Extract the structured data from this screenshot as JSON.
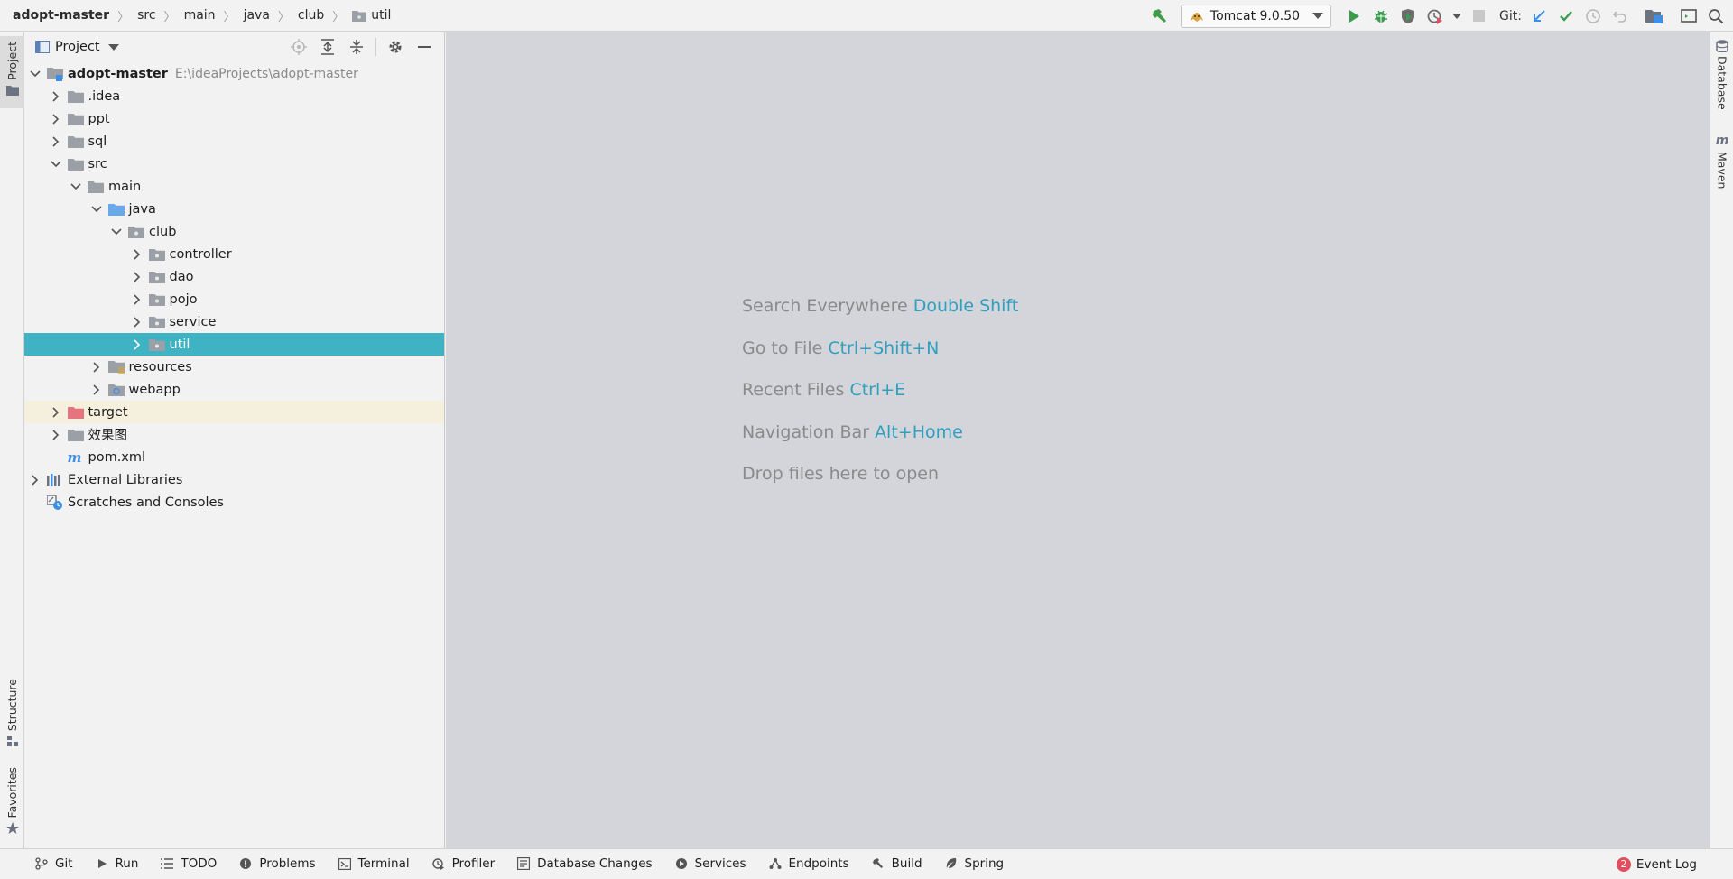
{
  "breadcrumb": [
    {
      "label": "adopt-master"
    },
    {
      "label": "src"
    },
    {
      "label": "main"
    },
    {
      "label": "java"
    },
    {
      "label": "club"
    },
    {
      "label": "util"
    }
  ],
  "toolbar": {
    "run_config_label": "Tomcat 9.0.50",
    "git_label": "Git:"
  },
  "left_stripe": {
    "project_tab": "Project",
    "structure_tab": "Structure",
    "favorites_tab": "Favorites"
  },
  "right_stripe": {
    "database_tab": "Database",
    "maven_tab": "Maven"
  },
  "project_panel": {
    "title": "Project",
    "tree": [
      {
        "label": "adopt-master",
        "path": "E:\\ideaProjects\\adopt-master",
        "depth": 0,
        "expanded": true,
        "icon": "module-folder-icon"
      },
      {
        "label": ".idea",
        "depth": 1,
        "expanded": false,
        "icon": "folder-icon"
      },
      {
        "label": "ppt",
        "depth": 1,
        "expanded": false,
        "icon": "folder-icon"
      },
      {
        "label": "sql",
        "depth": 1,
        "expanded": false,
        "icon": "folder-icon"
      },
      {
        "label": "src",
        "depth": 1,
        "expanded": true,
        "icon": "folder-icon"
      },
      {
        "label": "main",
        "depth": 2,
        "expanded": true,
        "icon": "folder-icon"
      },
      {
        "label": "java",
        "depth": 3,
        "expanded": true,
        "icon": "source-root-icon"
      },
      {
        "label": "club",
        "depth": 4,
        "expanded": true,
        "icon": "package-icon"
      },
      {
        "label": "controller",
        "depth": 5,
        "expanded": false,
        "icon": "package-icon"
      },
      {
        "label": "dao",
        "depth": 5,
        "expanded": false,
        "icon": "package-icon"
      },
      {
        "label": "pojo",
        "depth": 5,
        "expanded": false,
        "icon": "package-icon"
      },
      {
        "label": "service",
        "depth": 5,
        "expanded": false,
        "icon": "package-icon"
      },
      {
        "label": "util",
        "depth": 5,
        "expanded": false,
        "icon": "package-icon",
        "selected": true
      },
      {
        "label": "resources",
        "depth": 3,
        "expanded": false,
        "icon": "resources-folder-icon"
      },
      {
        "label": "webapp",
        "depth": 3,
        "expanded": false,
        "icon": "web-folder-icon"
      },
      {
        "label": "target",
        "depth": 1,
        "expanded": false,
        "icon": "excluded-folder-icon",
        "excluded": true
      },
      {
        "label": "效果图",
        "depth": 1,
        "expanded": false,
        "icon": "folder-icon"
      },
      {
        "label": "pom.xml",
        "depth": 1,
        "leaf": true,
        "icon": "maven-file-icon"
      },
      {
        "label": "External Libraries",
        "depth": 0,
        "expanded": false,
        "icon": "libraries-icon"
      },
      {
        "label": "Scratches and Consoles",
        "depth": 0,
        "leaf": true,
        "icon": "scratches-icon"
      }
    ]
  },
  "editor_hints": [
    {
      "text": "Search Everywhere",
      "shortcut": "Double Shift"
    },
    {
      "text": "Go to File",
      "shortcut": "Ctrl+Shift+N"
    },
    {
      "text": "Recent Files",
      "shortcut": "Ctrl+E"
    },
    {
      "text": "Navigation Bar",
      "shortcut": "Alt+Home"
    },
    {
      "text": "Drop files here to open",
      "shortcut": ""
    }
  ],
  "bottom_tabs": [
    {
      "label": "Git",
      "icon": "git-branch-icon"
    },
    {
      "label": "Run",
      "icon": "run-icon"
    },
    {
      "label": "TODO",
      "icon": "todo-icon"
    },
    {
      "label": "Problems",
      "icon": "problems-icon"
    },
    {
      "label": "Terminal",
      "icon": "terminal-icon"
    },
    {
      "label": "Profiler",
      "icon": "profiler-icon"
    },
    {
      "label": "Database Changes",
      "icon": "database-changes-icon"
    },
    {
      "label": "Services",
      "icon": "services-icon"
    },
    {
      "label": "Endpoints",
      "icon": "endpoints-icon"
    },
    {
      "label": "Build",
      "icon": "build-icon"
    },
    {
      "label": "Spring",
      "icon": "spring-icon"
    }
  ],
  "event_log": {
    "label": "Event Log",
    "count": "2"
  },
  "colors": {
    "selection": "#3fb2c3",
    "excluded_row": "#f4f0dd",
    "shortcut_text": "#2f9fbd",
    "editor_bg": "#d3d5db"
  }
}
